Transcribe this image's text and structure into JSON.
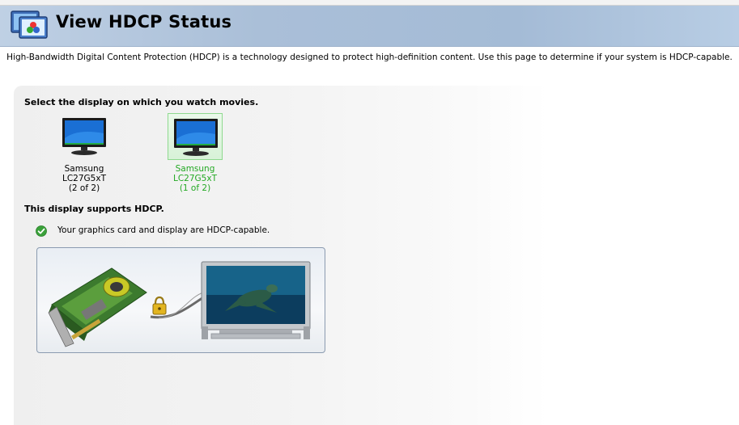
{
  "header": {
    "title": "View HDCP Status",
    "icon": "hdcp-display-icon"
  },
  "description": "High-Bandwidth Digital Content Protection (HDCP) is a technology designed to protect high-definition content. Use this page to determine if your system is HDCP-capable.",
  "select_label": "Select the display on which you watch movies.",
  "displays": [
    {
      "name": "Samsung LC27G5xT",
      "index": "(2 of 2)",
      "selected": false
    },
    {
      "name": "Samsung LC27G5xT",
      "index": "(1 of 2)",
      "selected": true
    }
  ],
  "support_label": "This display supports HDCP.",
  "status": {
    "icon": "green-check-icon",
    "text": "Your graphics card and display are HDCP-capable."
  },
  "illustration": {
    "description_icons": [
      "graphics-card-icon",
      "lock-icon",
      "tv-icon"
    ]
  },
  "colors": {
    "selected_text": "#23a923",
    "header_bg": "#a4bbd6"
  }
}
